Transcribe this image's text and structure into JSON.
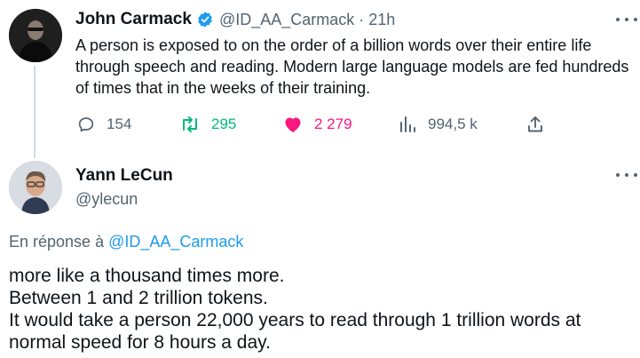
{
  "tweet": {
    "author_name": "John Carmack",
    "author_handle": "@ID_AA_Carmack",
    "separator": "·",
    "time": "21h",
    "text": "A person is exposed to on the order of a billion words over their entire life through speech and reading. Modern large language models are fed hundreds of times that in the weeks of their training.",
    "avatar_icon": "person-photo",
    "verified_icon": "verified-badge-icon",
    "stats": {
      "replies": "154",
      "retweets": "295",
      "likes": "2 279",
      "views": "994,5 k"
    }
  },
  "reply": {
    "author_name": "Yann LeCun",
    "author_handle": "@ylecun",
    "reply_prefix": "En réponse à",
    "reply_mention": "@ID_AA_Carmack",
    "lines": [
      "more like a thousand times more.",
      "Between 1 and 2 trillion tokens.",
      "It would take a person 22,000 years to read through 1 trillion words at",
      "normal speed for 8 hours a day."
    ]
  },
  "colors": {
    "text": "#0f1419",
    "secondary": "#536471",
    "accent": "#1d9bf0",
    "retweet": "#00ba7c",
    "like": "#f91880",
    "thread_line": "#cfd9de"
  }
}
